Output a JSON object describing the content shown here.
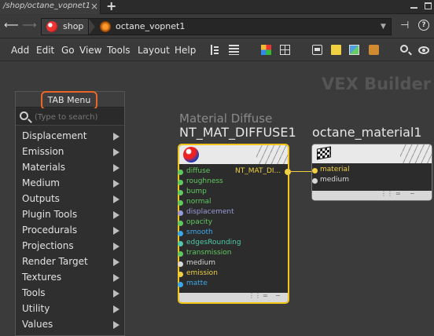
{
  "tab": {
    "label": "/shop/octane_vopnet1",
    "close": "×",
    "add": "+"
  },
  "path": {
    "shop": "shop",
    "network": "octane_vopnet1"
  },
  "menu": [
    "Add",
    "Edit",
    "Go",
    "View",
    "Tools",
    "Layout",
    "Help"
  ],
  "context_title": "VEX Builder",
  "tab_menu": {
    "title": "TAB Menu",
    "search_placeholder": "(Type to search)",
    "items": [
      "Displacement",
      "Emission",
      "Materials",
      "Medium",
      "Outputs",
      "Plugin Tools",
      "Procedurals",
      "Projections",
      "Render Target",
      "Textures",
      "Tools",
      "Utility",
      "Values"
    ]
  },
  "diffuse_node": {
    "subtitle": "Material Diffuse",
    "name": "NT_MAT_DIFFUSE1",
    "output": "NT_MAT_DI...",
    "inputs": [
      {
        "label": "diffuse",
        "color": "#5fc85f"
      },
      {
        "label": "roughness",
        "color": "#5fc85f"
      },
      {
        "label": "bump",
        "color": "#5fc85f"
      },
      {
        "label": "normal",
        "color": "#5fc85f"
      },
      {
        "label": "displacement",
        "color": "#9a9ad8"
      },
      {
        "label": "opacity",
        "color": "#5fc85f"
      },
      {
        "label": "smooth",
        "color": "#3aa8e8"
      },
      {
        "label": "edgesRounding",
        "color": "#4fc8a8"
      },
      {
        "label": "transmission",
        "color": "#5fc85f"
      },
      {
        "label": "medium",
        "color": "#d8d8d8"
      },
      {
        "label": "emission",
        "color": "#f0d040"
      },
      {
        "label": "matte",
        "color": "#3aa8e8"
      }
    ]
  },
  "octane_node": {
    "name": "octane_material1",
    "inputs": [
      {
        "label": "material",
        "color": "#f0d040"
      },
      {
        "label": "medium",
        "color": "#d8d8d8"
      }
    ]
  },
  "colors": {
    "selection": "#f0c419",
    "highlight": "#e8662a",
    "wire": "#f0d040"
  }
}
